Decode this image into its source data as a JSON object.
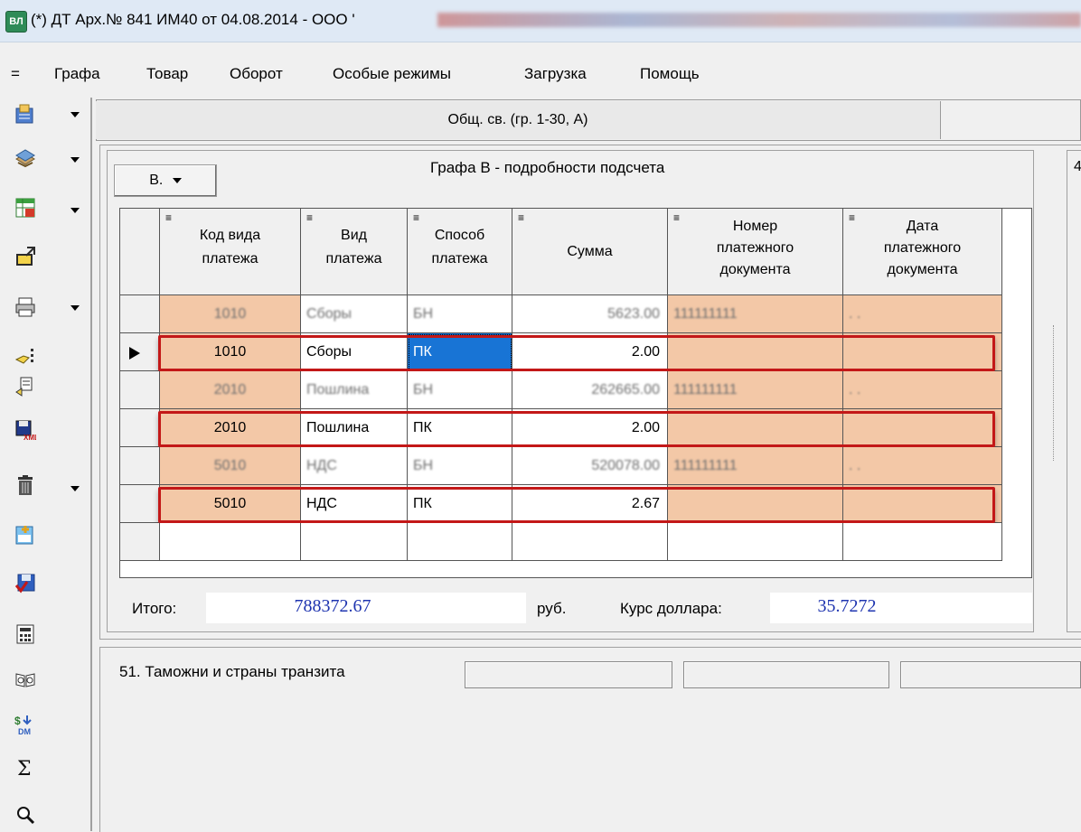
{
  "window": {
    "app_icon_text": "ВЛ",
    "title": "(*) ДТ Арх.№ 841 ИМ40 от 04.08.2014 - ООО '"
  },
  "menu": {
    "sys": "=",
    "items": [
      "Графа",
      "Товар",
      "Оборот",
      "Особые режимы",
      "Загрузка",
      "Помощь"
    ]
  },
  "toolbar": {
    "icons": [
      "document-icon",
      "database-icon",
      "table-icon",
      "export-icon",
      "print-icon",
      "signature-icon",
      "certificate-icon",
      "xml-save-icon",
      "delete-icon",
      "add-document-icon",
      "save-icon",
      "calculator-icon",
      "book-icon",
      "currency-icon",
      "sum-icon",
      "search-icon"
    ]
  },
  "tabs": {
    "main": "Общ. св. (гр. 1-30, А)"
  },
  "panel_b": {
    "dropdown_label": "В.",
    "title": "Графа В - подробности подсчета",
    "right_digit": "4"
  },
  "grid": {
    "column_mark": "≡",
    "headers": [
      [
        "Код вида",
        "платежа"
      ],
      [
        "Вид",
        "платежа"
      ],
      [
        "Способ",
        "платежа"
      ],
      [
        "Сумма"
      ],
      [
        "Номер",
        "платежного",
        "документа"
      ],
      [
        "Дата",
        "платежного",
        "документа"
      ]
    ],
    "rows": [
      {
        "code": "1010",
        "type": "Сборы",
        "method": "БН",
        "amount": "5623.00",
        "doc_no": "111111111",
        "doc_date": ". .",
        "blurred": true,
        "current": false,
        "highlighted": false
      },
      {
        "code": "1010",
        "type": "Сборы",
        "method": "ПК",
        "amount": "2.00",
        "doc_no": "",
        "doc_date": "",
        "blurred": false,
        "current": true,
        "highlighted": true
      },
      {
        "code": "2010",
        "type": "Пошлина",
        "method": "БН",
        "amount": "262665.00",
        "doc_no": "111111111",
        "doc_date": ". .",
        "blurred": true,
        "current": false,
        "highlighted": false
      },
      {
        "code": "2010",
        "type": "Пошлина",
        "method": "ПК",
        "amount": "2.00",
        "doc_no": "",
        "doc_date": "",
        "blurred": false,
        "current": false,
        "highlighted": true
      },
      {
        "code": "5010",
        "type": "НДС",
        "method": "БН",
        "amount": "520078.00",
        "doc_no": "111111111",
        "doc_date": ". .",
        "blurred": true,
        "current": false,
        "highlighted": false
      },
      {
        "code": "5010",
        "type": "НДС",
        "method": "ПК",
        "amount": "2.67",
        "doc_no": "",
        "doc_date": "",
        "blurred": false,
        "current": false,
        "highlighted": true
      }
    ]
  },
  "totals": {
    "total_label": "Итого:",
    "total_value": "788372.67",
    "currency": "руб.",
    "rate_label": "Курс доллара:",
    "rate_value": "35.7272"
  },
  "section51": {
    "label": "51. Таможни и страны транзита"
  },
  "colors": {
    "row_fill": "#f3c8a7",
    "highlight_border": "#c31818",
    "value_text": "#1f35b0",
    "selection": "#1874d5"
  }
}
